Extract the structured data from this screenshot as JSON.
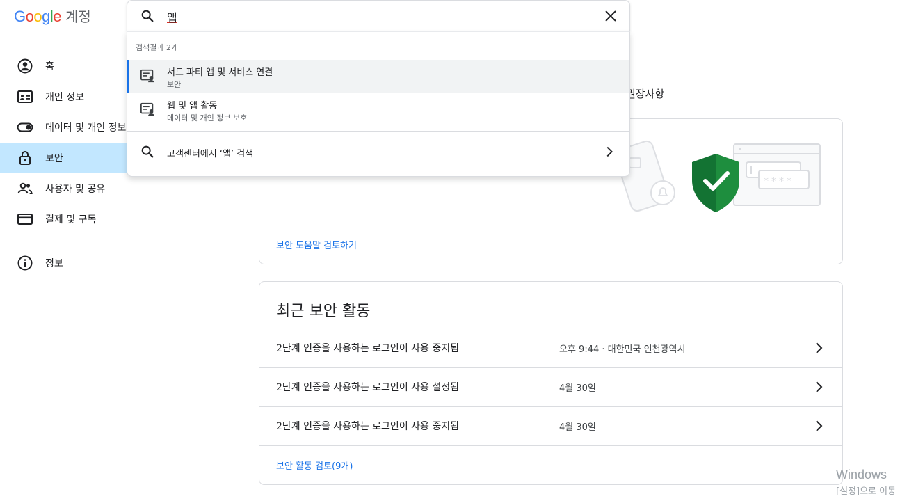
{
  "header": {
    "logo_letters": [
      "G",
      "o",
      "o",
      "g",
      "l",
      "e"
    ],
    "logo_colors": [
      "#4285F4",
      "#EA4335",
      "#FBBC05",
      "#4285F4",
      "#34A853",
      "#EA4335"
    ],
    "product": "계정"
  },
  "search": {
    "query_prefix": "",
    "query_underlined": "앱",
    "icon": "search-icon",
    "clear_icon": "close-icon"
  },
  "dropdown": {
    "result_count": "검색결과 2개",
    "results": [
      {
        "title": "서드 파티 앱 및 서비스 연결",
        "subtitle": "보안",
        "icon": "settings-account-icon"
      },
      {
        "title": "웹 및 앱 활동",
        "subtitle": "데이터 및 개인 정보 보호",
        "icon": "settings-account-icon"
      }
    ],
    "help_search": "고객센터에서 ‘앱’ 검색"
  },
  "sidebar": {
    "items": [
      {
        "label": "홈",
        "icon": "account-circle-icon"
      },
      {
        "label": "개인 정보",
        "icon": "id-card-icon"
      },
      {
        "label": "데이터 및 개인 정보 보호",
        "icon": "toggle-icon"
      },
      {
        "label": "보안",
        "icon": "lock-icon"
      },
      {
        "label": "사용자 및 공유",
        "icon": "people-icon"
      },
      {
        "label": "결제 및 구독",
        "icon": "credit-card-icon"
      }
    ],
    "info": {
      "label": "정보",
      "icon": "info-icon"
    }
  },
  "security_card": {
    "rec_text": "권장사항",
    "link": "보안 도움말 검토하기",
    "password_mask": "****"
  },
  "recent_activity": {
    "title": "최근 보안 활동",
    "rows": [
      {
        "desc": "2단계 인증을 사용하는 로그인이 사용 중지됨",
        "when": "오후 9:44 · 대한민국 인천광역시"
      },
      {
        "desc": "2단계 인증을 사용하는 로그인이 사용 설정됨",
        "when": "4월 30일"
      },
      {
        "desc": "2단계 인증을 사용하는 로그인이 사용 중지됨",
        "when": "4월 30일"
      }
    ],
    "review_link": "보안 활동 검토(9개)"
  },
  "watermark": {
    "line1": "Windows",
    "line2": "[설정]으로 이동"
  },
  "colors": {
    "accent": "#1a73e8",
    "active_nav_bg": "#c2e7ff",
    "shield_green": "#1e8e3e"
  }
}
